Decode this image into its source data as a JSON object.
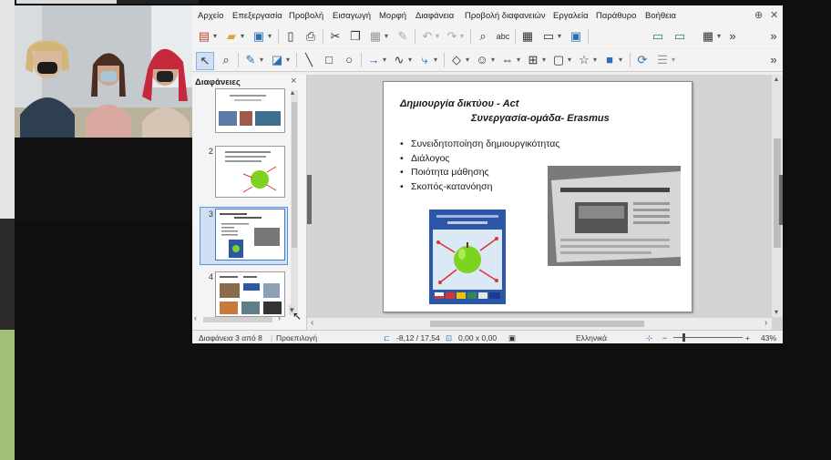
{
  "menu": [
    "Αρχείο",
    "Επεξεργασία",
    "Προβολή",
    "Εισαγωγή",
    "Μορφή",
    "Διαφάνεια",
    "Προβολή διαφανειών",
    "Εργαλεία",
    "Παράθυρο",
    "Βοήθεια"
  ],
  "toolbar": {
    "overflow": "»"
  },
  "slides_pane": {
    "title": "Διαφάνειες",
    "close": "×",
    "slide_numbers": [
      "2",
      "3",
      "4"
    ],
    "thumb3_title": "Δημιουργία δικτύου - Act"
  },
  "slide": {
    "title_line1": "Δημιουργία δικτύου -  Act",
    "title_line2": "Συνεργασία-ομάδα- Erasmus",
    "bullets": [
      "Συνειδητοποίηση δημιουργικότητας",
      "Διάλογος",
      "Ποιότητα μάθησης",
      "Σκοπός-κατανόηση"
    ],
    "bullet_char": "•"
  },
  "status": {
    "slide_info": "Διαφάνεια 3 από 8",
    "layout": "Προεπιλογή",
    "position": "-8,12 / 17,54",
    "size": "0,00 x 0,00",
    "language": "Ελληνικά",
    "zoom": "43%",
    "zoom_minus": "−",
    "zoom_plus": "+"
  },
  "colors": {
    "accent": "#3a7bd5",
    "poster_blue": "#2b57a6",
    "apple_green": "#7ed321"
  }
}
